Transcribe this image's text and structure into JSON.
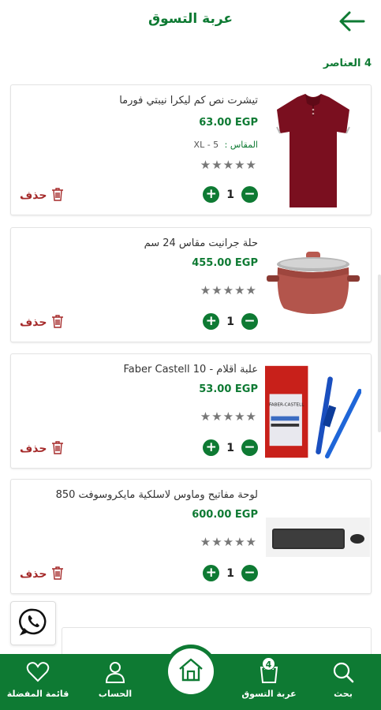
{
  "header": {
    "title": "عربة التسوق"
  },
  "cart": {
    "count_label": "4 العناصر"
  },
  "items": [
    {
      "name": "تيشرت نص كم ليكرا نيبتي فورما",
      "price": "63.00 EGP",
      "size_label": "المقاس :",
      "size_value": "XL - 5",
      "qty": "1",
      "delete_label": "حذف",
      "rating": 0
    },
    {
      "name": "حلة جرانيت مقاس 24 سم",
      "price": "455.00 EGP",
      "qty": "1",
      "delete_label": "حذف",
      "rating": 0
    },
    {
      "name": "علبة أقلام - Faber Castell 10",
      "price": "53.00 EGP",
      "qty": "1",
      "delete_label": "حذف",
      "rating": 0
    },
    {
      "name": "لوحة مفاتيح وماوس لاسلكية مايكروسوفت 850",
      "price": "600.00 EGP",
      "qty": "1",
      "delete_label": "حذف",
      "rating": 0
    }
  ],
  "bottom_nav": {
    "search": "بحث",
    "cart": "عربة التسوق",
    "cart_badge": "4",
    "account": "الحساب",
    "wishlist": "قائمة المفضلة"
  },
  "colors": {
    "primary": "#0e7a33",
    "delete": "#a52a2a"
  }
}
